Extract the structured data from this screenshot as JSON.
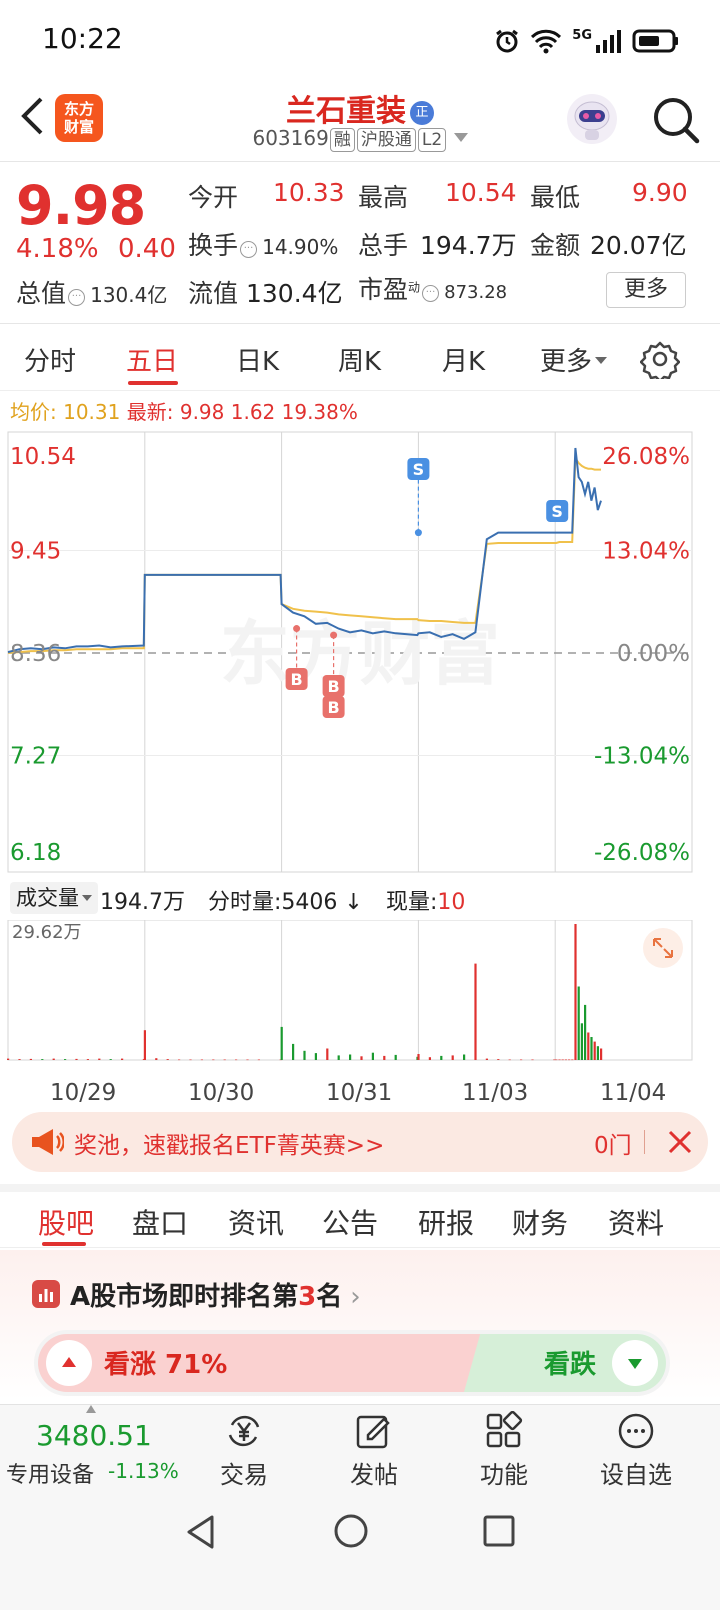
{
  "status": {
    "time": "10:22",
    "network": "5G"
  },
  "header": {
    "logo": "东方财富",
    "name": "兰石重装",
    "badge": "正",
    "code": "603169",
    "tag1": "融",
    "tag2": "沪股通",
    "tag3": "L2"
  },
  "quote": {
    "price": "9.98",
    "pct": "4.18%",
    "change": "0.40",
    "open_label": "今开",
    "open": "10.33",
    "high_label": "最高",
    "high": "10.54",
    "low_label": "最低",
    "low": "9.90",
    "turnover_label": "换手",
    "turnover": "14.90%",
    "vol_label": "总手",
    "vol": "194.7万",
    "amount_label": "金额",
    "amount": "20.07亿",
    "mcap_label": "总值",
    "mcap": "130.4亿",
    "float_label": "流值",
    "float": "130.4亿",
    "pe_label": "市盈",
    "pe_sup": "动",
    "pe": "873.28",
    "more": "更多"
  },
  "chart_tabs": [
    "分时",
    "五日",
    "日K",
    "周K",
    "月K",
    "更多"
  ],
  "avg_line": {
    "avg_label": "均价:",
    "avg": "10.31",
    "latest_label": "最新:",
    "latest": "9.98",
    "chg": "1.62",
    "pct": "19.38%"
  },
  "chart_data": {
    "type": "line",
    "title": "",
    "days": [
      "10/29",
      "10/30",
      "10/31",
      "11/03",
      "11/04"
    ],
    "y_labels": [
      "10.54",
      "9.45",
      "8.36",
      "7.27",
      "6.18"
    ],
    "pct_labels": [
      "26.08%",
      "13.04%",
      "0.00%",
      "-13.04%",
      "-26.08%"
    ],
    "ylim": [
      6.18,
      10.54
    ],
    "baseline": 8.36,
    "series": [
      {
        "values": [
          8.37,
          8.4,
          8.41,
          8.4,
          8.42,
          8.41,
          8.43,
          8.43,
          8.44,
          8.42,
          8.43,
          8.44,
          9.19,
          9.19,
          9.19,
          9.19,
          9.19,
          9.19,
          9.19,
          9.19,
          9.19,
          9.19,
          9.19,
          9.19,
          8.88,
          8.79,
          8.75,
          8.67,
          8.68,
          8.62,
          8.58,
          8.6,
          8.57,
          8.59,
          8.57,
          8.55,
          8.57,
          8.58,
          8.53,
          8.56,
          8.51,
          8.58,
          9.57,
          9.64,
          9.64,
          9.64,
          9.64,
          9.64,
          9.64,
          9.64,
          9.64,
          9.64,
          9.64,
          9.64,
          10.54,
          10.23,
          10.18,
          10.05,
          10.18,
          9.98,
          10.12,
          9.88,
          9.98
        ]
      },
      {
        "values": [
          8.36,
          8.37,
          8.38,
          8.38,
          8.39,
          8.39,
          8.4,
          8.4,
          8.4,
          8.4,
          8.41,
          8.41,
          9.19,
          9.19,
          9.19,
          9.19,
          9.19,
          9.19,
          9.19,
          9.19,
          9.19,
          9.19,
          9.19,
          9.19,
          8.88,
          8.83,
          8.81,
          8.8,
          8.79,
          8.77,
          8.76,
          8.75,
          8.74,
          8.73,
          8.72,
          8.72,
          8.71,
          8.7,
          8.7,
          8.69,
          8.68,
          8.68,
          9.52,
          9.53,
          9.53,
          9.53,
          9.53,
          9.53,
          9.53,
          9.54,
          9.54,
          9.54,
          9.54,
          9.54,
          10.43,
          10.38,
          10.35,
          10.33,
          10.32,
          10.32,
          10.31,
          10.31,
          10.31
        ]
      }
    ],
    "markers": [
      {
        "label": "S",
        "day": 3,
        "price": 9.64
      },
      {
        "label": "S",
        "day": 4,
        "price": 10.4
      },
      {
        "label": "B",
        "day": 2,
        "price": 8.62
      },
      {
        "label": "B",
        "day": 2,
        "price": 8.55
      },
      {
        "label": "B",
        "day": 2,
        "price": 8.55
      }
    ],
    "volume_max_label": "29.62万",
    "volume": {
      "ylim": [
        0,
        29.62
      ],
      "values": [
        0.3,
        0.2,
        0.25,
        0.2,
        0.3,
        0.2,
        0.25,
        0.2,
        0.3,
        0.2,
        0.3,
        0.2,
        6.5,
        0.4,
        0.2,
        0.1,
        0.1,
        0.1,
        0.1,
        0.1,
        0.1,
        0.1,
        0.1,
        0.1,
        7.2,
        3.5,
        2.0,
        1.5,
        2.5,
        1.0,
        1.2,
        0.8,
        1.6,
        0.9,
        1.1,
        0.7,
        1.3,
        0.6,
        0.9,
        1.0,
        1.2,
        21.0,
        0.3,
        0.2,
        0.1,
        0.1,
        0.1,
        0.1,
        0.1,
        0.1,
        0.1,
        0.1,
        0.1,
        0.1,
        29.62,
        16.0,
        8.0,
        12.0,
        6.0,
        5.0,
        4.0,
        3.0,
        2.5
      ]
    }
  },
  "volume_bar": {
    "label": "成交量",
    "value": "194.7万",
    "tick_label": "分时量:",
    "tick": "5406",
    "now_label": "现量:",
    "now": "10"
  },
  "banner": {
    "text": "奖池，速戳报名ETF菁英赛>>",
    "side": "0门"
  },
  "section_tabs": [
    "股吧",
    "盘口",
    "资讯",
    "公告",
    "研报",
    "财务",
    "资料"
  ],
  "ranking": {
    "text_prefix": "A股市场即时排名第",
    "rank": "3",
    "text_suffix": "名",
    "up_label": "看涨 71%",
    "down_label": "看跌"
  },
  "bottom_nav": {
    "index_value": "3480.51",
    "index_name": "专用设备",
    "index_change": "-1.13%",
    "trade": "交易",
    "post": "发帖",
    "func": "功能",
    "watch": "设自选"
  },
  "colors": {
    "accent": "#e0312f",
    "price_line": "#3a6fb0",
    "avg_line": "#f0c14b",
    "down": "#1a9a2f"
  }
}
